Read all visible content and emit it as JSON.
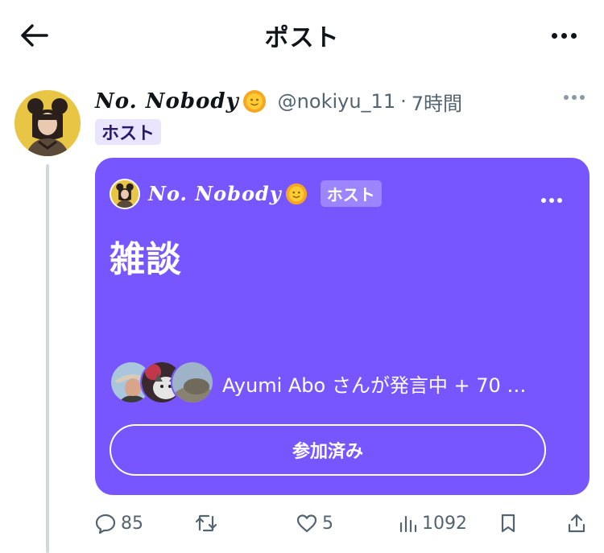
{
  "header": {
    "title": "ポスト"
  },
  "post": {
    "display_name": "No. Nobody",
    "handle": "@nokiyu_11",
    "separator": "·",
    "time": "7時間",
    "badge": "ホスト"
  },
  "space": {
    "host_name": "No. Nobody",
    "host_badge": "ホスト",
    "title": "雑談",
    "speakers_text": "Ayumi Abo さんが発言中 + 70 …",
    "joined_label": "参加済み",
    "card_color": "#7856ff"
  },
  "actions": {
    "replies": "85",
    "reposts": "",
    "likes": "5",
    "views": "1092"
  }
}
